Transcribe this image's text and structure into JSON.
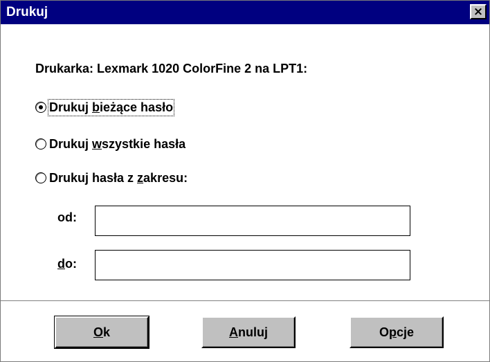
{
  "window": {
    "title": "Drukuj",
    "close_glyph": "×"
  },
  "printer_label": "Drukarka: Lexmark 1020 ColorFine 2 na LPT1:",
  "options": [
    {
      "pre": "Drukuj ",
      "mnemonic": "b",
      "post": "ieżące hasło",
      "selected": true
    },
    {
      "pre": "Drukuj ",
      "mnemonic": "w",
      "post": "szystkie hasła",
      "selected": false
    },
    {
      "pre": "Drukuj hasła z ",
      "mnemonic": "z",
      "post": "akresu:",
      "selected": false
    }
  ],
  "range": {
    "from_label": "od:",
    "from_value": "",
    "to_label_mnemonic": "d",
    "to_label_post": "o:",
    "to_value": ""
  },
  "buttons": {
    "ok": {
      "mnemonic": "O",
      "post": "k"
    },
    "cancel": {
      "mnemonic": "A",
      "post": "nuluj"
    },
    "options": {
      "pre": "O",
      "mnemonic": "p",
      "post": "cje"
    }
  },
  "colors": {
    "titlebar": "#000080",
    "button_face": "#c0c0c0"
  },
  "icons": {
    "close": "close-icon",
    "radio_selected": "radio-selected-icon",
    "radio_empty": "radio-empty-icon"
  }
}
